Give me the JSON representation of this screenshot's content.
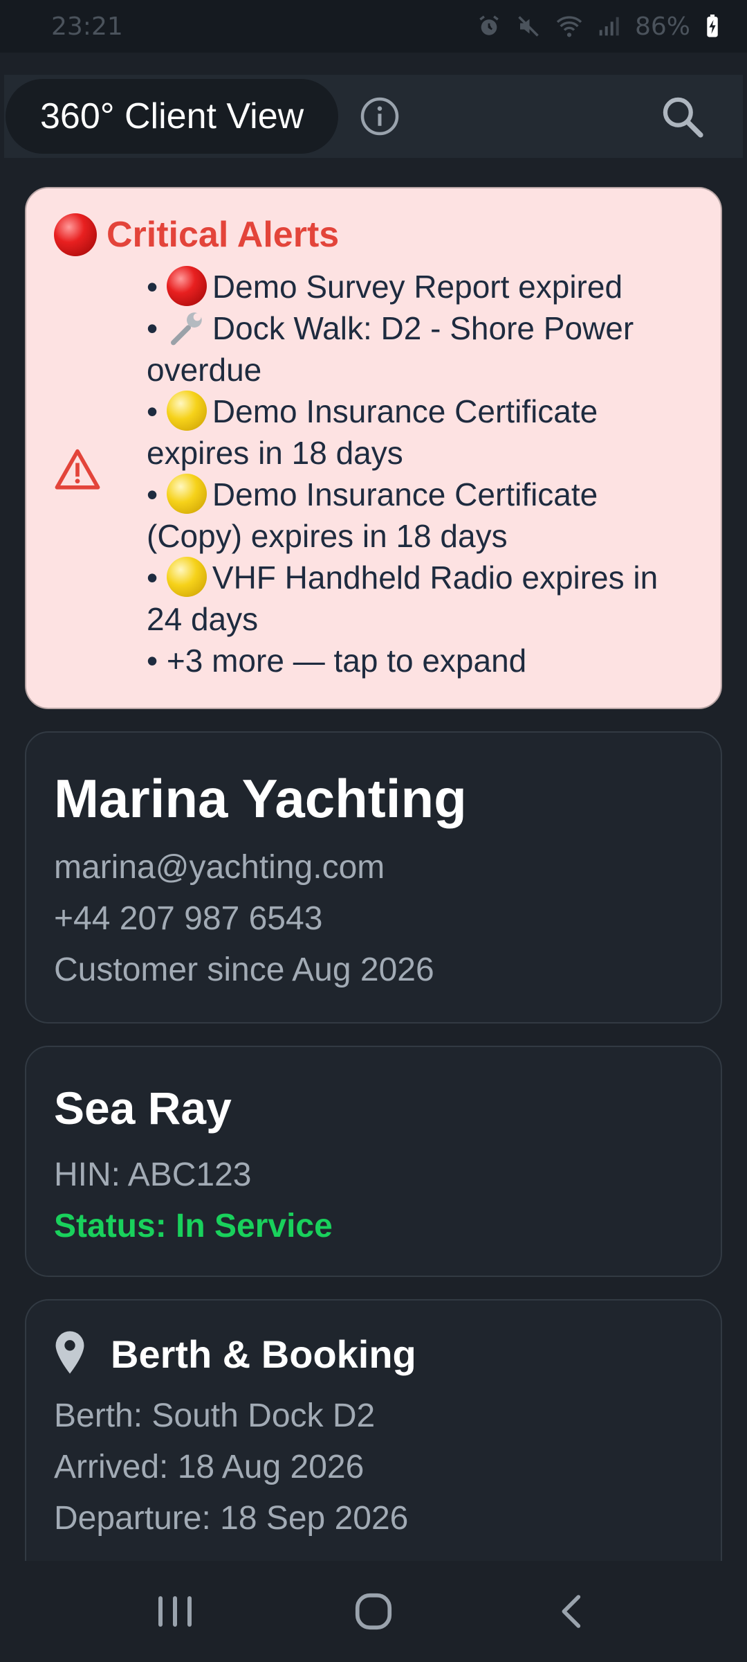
{
  "status_bar": {
    "time": "23:21",
    "battery": "86%",
    "icons": [
      "alarm-icon",
      "mute-icon",
      "wifi-icon",
      "signal-icon",
      "battery-charging-icon"
    ]
  },
  "app_bar": {
    "title": "360° Client View",
    "info_icon": "info-icon",
    "search_icon": "search-icon"
  },
  "alerts": {
    "title": "Critical Alerts",
    "items": [
      {
        "icon": "red-circle",
        "text": "Demo Survey Report expired"
      },
      {
        "icon": "wrench",
        "text": "Dock Walk: D2 - Shore Power overdue"
      },
      {
        "icon": "yellow-circle",
        "text": "Demo Insurance Certificate expires in 18 days"
      },
      {
        "icon": "yellow-circle",
        "text": "Demo Insurance Certificate (Copy) expires in 18 days"
      },
      {
        "icon": "yellow-circle",
        "text": "VHF Handheld Radio expires in 24 days"
      },
      {
        "icon": "none",
        "text": "+3 more — tap to expand"
      }
    ]
  },
  "client": {
    "name": "Marina Yachting",
    "email": "marina@yachting.com",
    "phone": "+44 207 987 6543",
    "since": "Customer since Aug 2026"
  },
  "vessel": {
    "name": "Sea Ray",
    "hin": "HIN: ABC123",
    "status": "Status: In Service",
    "status_color": "#19d15c"
  },
  "berth": {
    "title": "Berth & Booking",
    "berth": "Berth: South Dock D2",
    "arrived": "Arrived: 18 Aug 2026",
    "departure": "Departure: 18 Sep 2026"
  },
  "nav": {
    "recents": "recents-icon",
    "home": "home-icon",
    "back": "back-icon"
  },
  "colors": {
    "alert_bg": "#fde2e2",
    "alert_title": "#e3443a",
    "background": "#1c2128",
    "card": "#1f252d"
  }
}
